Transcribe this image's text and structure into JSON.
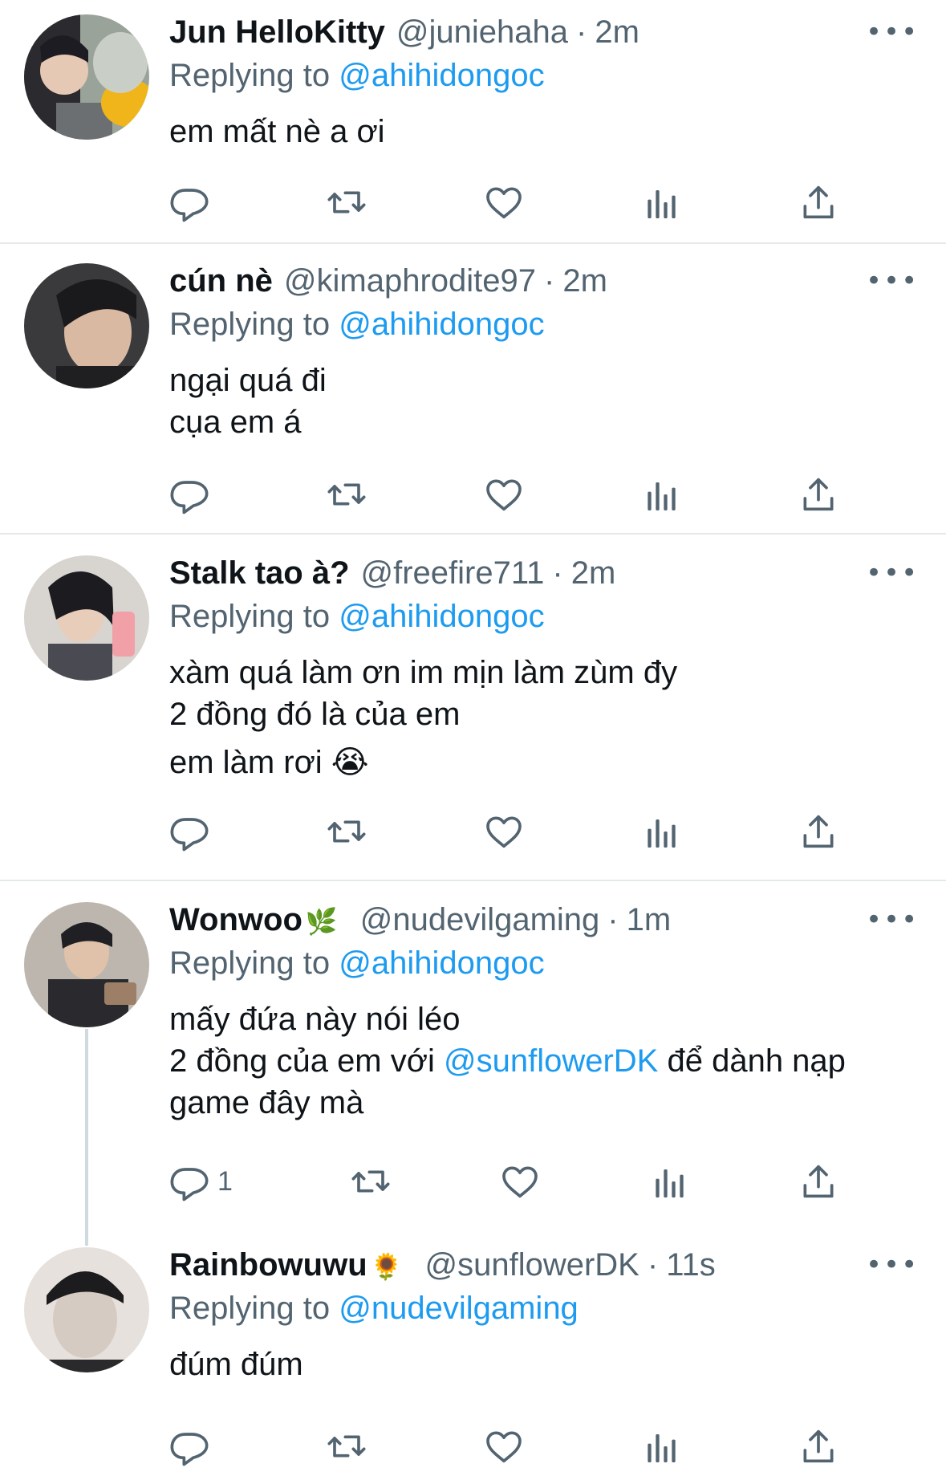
{
  "tweets": [
    {
      "name": "Jun HelloKitty",
      "name_emoji": "",
      "handle": "@juniehaha",
      "time": "2m",
      "replying_label": "Replying to",
      "replying_to": "@ahihidongoc",
      "text": "em mất nè a ơi",
      "reply_count": ""
    },
    {
      "name": "cún nè",
      "name_emoji": "",
      "handle": "@kimaphrodite97",
      "time": "2m",
      "replying_label": "Replying to",
      "replying_to": "@ahihidongoc",
      "text": "ngại quá đi\ncụa em á",
      "reply_count": ""
    },
    {
      "name": "Stalk tao à?",
      "name_emoji": "",
      "handle": "@freefire711",
      "time": "2m",
      "replying_label": "Replying to",
      "replying_to": "@ahihidongoc",
      "text": "xàm quá làm ơn im mịn làm zùm đy\n2 đồng đó là của em",
      "text2": "em làm rơi 😭",
      "reply_count": ""
    },
    {
      "name": "Wonwoo",
      "name_emoji": "🌿",
      "handle": "@nudevilgaming",
      "time": "1m",
      "replying_label": "Replying to",
      "replying_to": "@ahihidongoc",
      "text_part1": "mấy đứa này nói léo\n2 đồng của em với ",
      "text_mention": "@sunflowerDK",
      "text_part2": " để dành nạp\ngame đây mà",
      "reply_count": "1"
    },
    {
      "name": "Rainbowuwu",
      "name_emoji": "🌻",
      "handle": "@sunflowerDK",
      "time": "11s",
      "replying_label": "Replying to",
      "replying_to": "@nudevilgaming",
      "text": "đúm đúm",
      "reply_count": ""
    }
  ],
  "separator": "·",
  "more_icon": "•••",
  "icons": [
    "reply-icon",
    "retweet-icon",
    "like-icon",
    "analytics-icon",
    "share-icon"
  ],
  "colors": {
    "link": "#1d9bf0",
    "secondary": "#536471",
    "divider": "#e6e9ec"
  }
}
